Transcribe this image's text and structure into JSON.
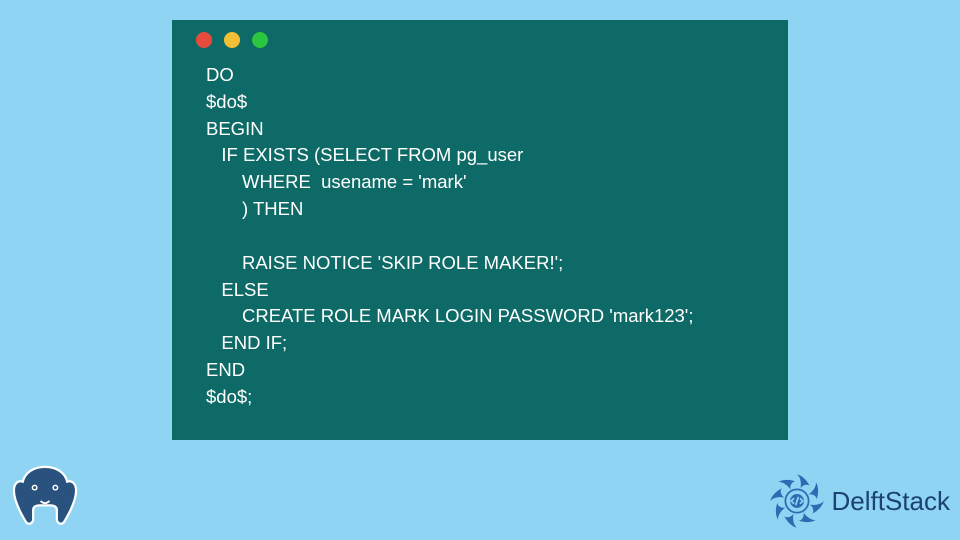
{
  "window": {
    "dots": [
      "red",
      "yellow",
      "green"
    ]
  },
  "code": {
    "lines": [
      "DO",
      "$do$",
      "BEGIN",
      "   IF EXISTS (SELECT FROM pg_user",
      "       WHERE  usename = 'mark'",
      "       ) THEN",
      "",
      "       RAISE NOTICE 'SKIP ROLE MAKER!';",
      "   ELSE",
      "       CREATE ROLE MARK LOGIN PASSWORD 'mark123';",
      "   END IF;",
      "END",
      "$do$;"
    ]
  },
  "branding": {
    "delftstack_label": "DelftStack"
  },
  "colors": {
    "page_bg": "#8fd4f2",
    "window_bg": "#0e6a66",
    "code_fg": "#ffffff",
    "brand_text": "#1b4272",
    "brand_accent": "#2f6bb3"
  }
}
